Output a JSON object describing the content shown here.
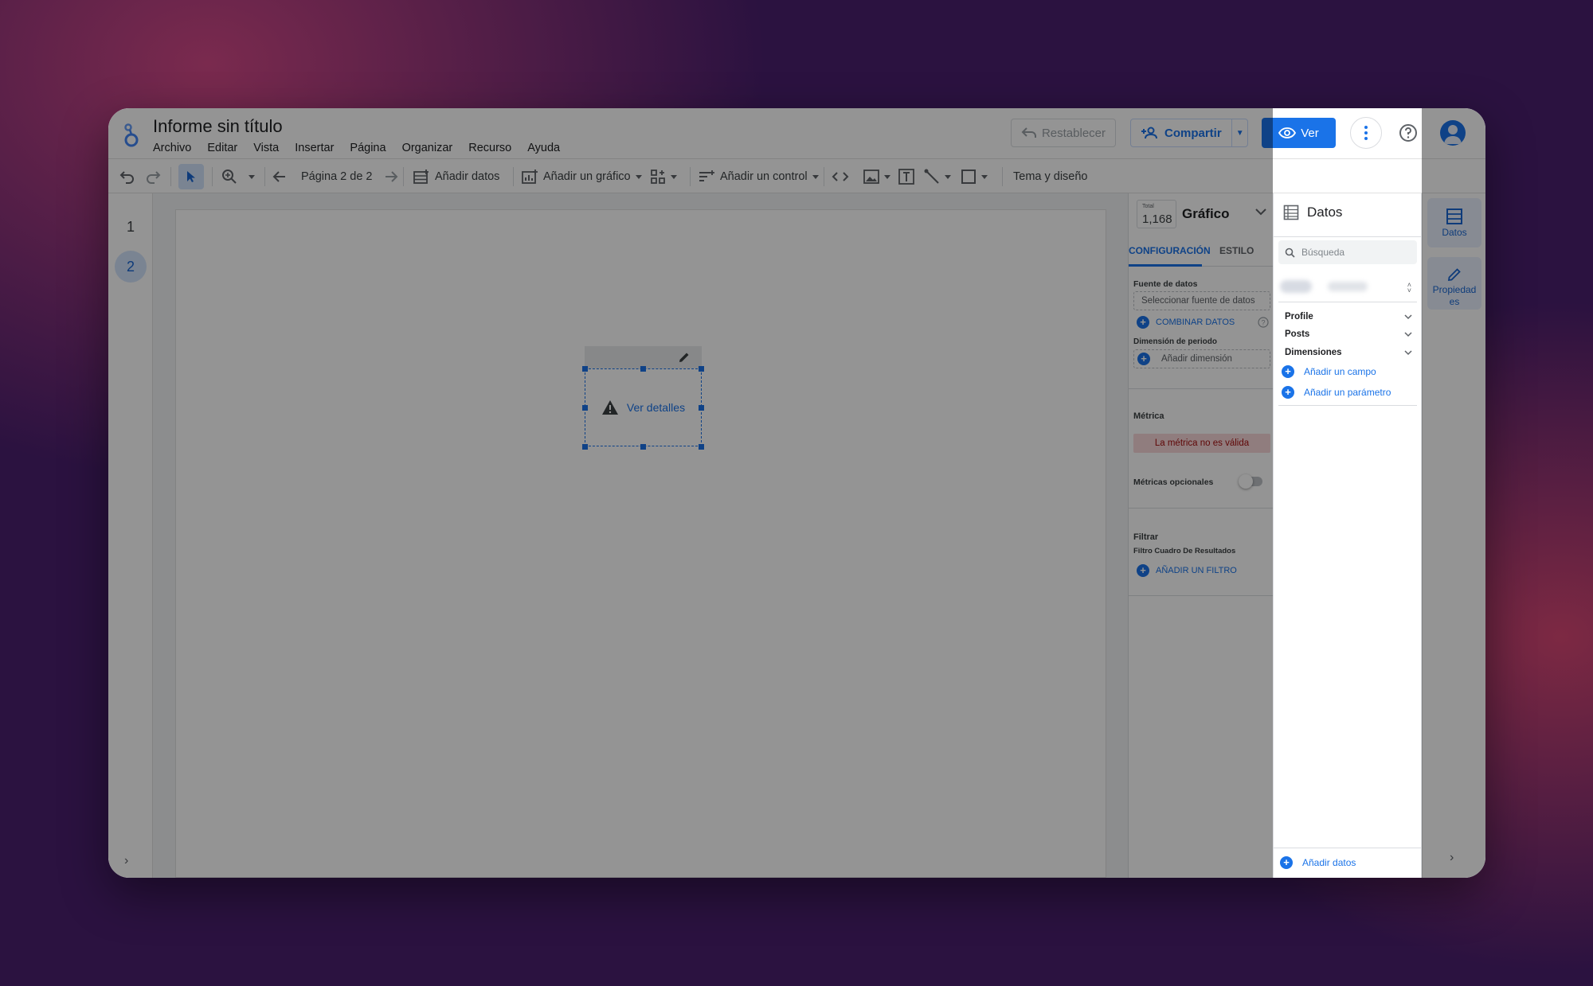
{
  "app": {
    "title": "Informe sin título",
    "menu": [
      "Archivo",
      "Editar",
      "Vista",
      "Insertar",
      "Página",
      "Organizar",
      "Recurso",
      "Ayuda"
    ],
    "reset_label": "Restablecer",
    "share_label": "Compartir",
    "view_label": "Ver"
  },
  "toolbar": {
    "page_indicator": "Página 2 de 2",
    "add_data": "Añadir datos",
    "add_chart": "Añadir un gráfico",
    "add_control": "Añadir un control",
    "theme": "Tema y diseño"
  },
  "pages": [
    "1",
    "2"
  ],
  "canvas": {
    "chart_link": "Ver detalles"
  },
  "props": {
    "total_label": "Total",
    "total_value": "1,168",
    "title": "Gráfico",
    "tab_config": "CONFIGURACIÓN",
    "tab_style": "ESTILO",
    "data_source_label": "Fuente de datos",
    "data_source_placeholder": "Seleccionar fuente de datos",
    "blend_label": "COMBINAR DATOS",
    "period_label": "Dimensión de periodo",
    "add_dimension": "Añadir dimensión",
    "metric_label": "Métrica",
    "metric_error": "La métrica no es válida",
    "optional_metrics": "Métricas opcionales",
    "filter_label": "Filtrar",
    "filter_sub": "Filtro Cuadro De Resultados",
    "add_filter": "AÑADIR UN FILTRO"
  },
  "datos": {
    "title": "Datos",
    "search_placeholder": "Búsqueda",
    "groups": [
      "Profile",
      "Posts",
      "Dimensiones"
    ],
    "add_field": "Añadir un campo",
    "add_param": "Añadir un parámetro",
    "add_data": "Añadir datos"
  },
  "rail": {
    "datos": "Datos",
    "props_line1": "Propiedad",
    "props_line2": "es"
  },
  "colors": {
    "accent": "#1a73e8",
    "error_bg": "#f8d7da"
  }
}
